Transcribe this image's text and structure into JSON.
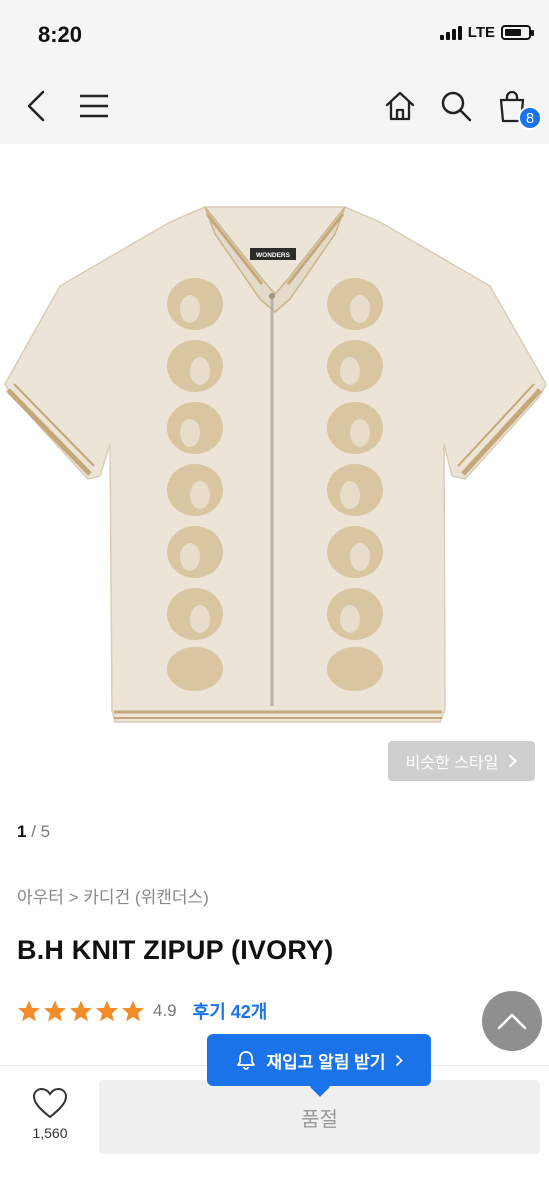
{
  "status_bar": {
    "time": "8:20",
    "network": "LTE"
  },
  "nav": {
    "cart_count": "8"
  },
  "product": {
    "similar_style_label": "비슷한 스타일",
    "pager_current": "1",
    "pager_separator": " / ",
    "pager_total": "5",
    "category": "아우터 > 카디건 (위캔더스)",
    "title": "B.H KNIT ZIPUP (IVORY)",
    "rating": "4.9",
    "review_label": "후기 42개",
    "label_text": "WONDERS"
  },
  "bottom": {
    "like_count": "1,560",
    "soldout_label": "품절",
    "restock_label": "재입고 알림 받기"
  },
  "colors": {
    "accent": "#1a73e8",
    "star": "#f28c28",
    "garment": "#ece4d6",
    "embroidery": "#d8c29a"
  }
}
